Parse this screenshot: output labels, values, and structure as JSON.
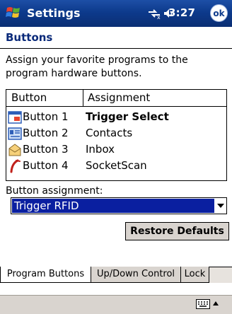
{
  "titlebar": {
    "app_title": "Settings",
    "time": "3:27",
    "ok_label": "ok"
  },
  "page": {
    "heading": "Buttons",
    "description": "Assign your favorite programs to the program hardware buttons."
  },
  "list": {
    "col_button": "Button",
    "col_assignment": "Assignment",
    "rows": [
      {
        "button": "Button 1",
        "assignment": "Trigger Select",
        "icon": "trigger-app-icon"
      },
      {
        "button": "Button 2",
        "assignment": "Contacts",
        "icon": "contacts-icon"
      },
      {
        "button": "Button 3",
        "assignment": "Inbox",
        "icon": "inbox-envelope-icon"
      },
      {
        "button": "Button 4",
        "assignment": "SocketScan",
        "icon": "socketscan-icon"
      }
    ]
  },
  "assignment": {
    "label": "Button assignment:",
    "selected": "Trigger RFID"
  },
  "restore_label": "Restore Defaults",
  "tabs": [
    "Program Buttons",
    "Up/Down Control",
    "Lock"
  ],
  "colors": {
    "titlebar": "#0d3a8c",
    "selection": "#0a1fa0",
    "heading": "#0a2a7a"
  }
}
